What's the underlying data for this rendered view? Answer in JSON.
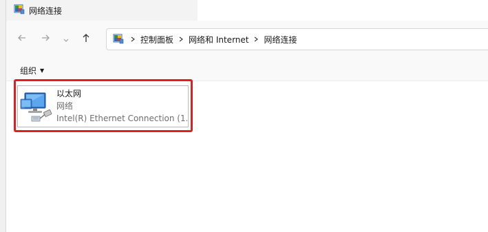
{
  "window": {
    "title": "网络连接"
  },
  "nav": {
    "back_icon": "arrow-left-icon",
    "forward_icon": "arrow-right-icon",
    "recent_icon": "chevron-down-icon",
    "up_icon": "arrow-up-icon"
  },
  "address": {
    "crumbs": [
      "控制面板",
      "网络和 Internet",
      "网络连接"
    ]
  },
  "commandbar": {
    "organize_label": "组织"
  },
  "connection": {
    "name": "以太网",
    "status": "网络",
    "device": "Intel(R) Ethernet Connection (1..."
  },
  "colors": {
    "highlight": "#e02020",
    "item_border": "#b8b8b8"
  }
}
